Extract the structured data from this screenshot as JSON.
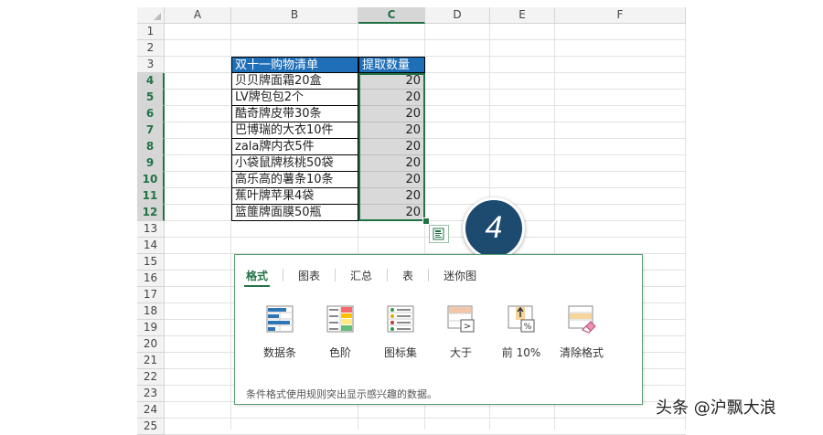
{
  "columns": [
    "A",
    "B",
    "C",
    "D",
    "E",
    "F"
  ],
  "rows": [
    "1",
    "2",
    "3",
    "4",
    "5",
    "6",
    "7",
    "8",
    "9",
    "10",
    "11",
    "12",
    "13",
    "14",
    "15",
    "16",
    "17",
    "18",
    "19",
    "20",
    "21",
    "22",
    "23",
    "24",
    "25"
  ],
  "table": {
    "header": [
      "双十一购物清单",
      "提取数量"
    ],
    "items": [
      {
        "name": "贝贝牌面霜20盒",
        "qty": "20"
      },
      {
        "name": "LV牌包包2个",
        "qty": "20"
      },
      {
        "name": "酷奇牌皮带30条",
        "qty": "20"
      },
      {
        "name": "巴博瑞的大衣10件",
        "qty": "20"
      },
      {
        "name": "zala牌内衣5件",
        "qty": "20"
      },
      {
        "name": "小袋鼠牌核桃50袋",
        "qty": "20"
      },
      {
        "name": "高乐高的薯条10条",
        "qty": "20"
      },
      {
        "name": "蕉叶牌苹果4袋",
        "qty": "20"
      },
      {
        "name": "篮篚牌面膜50瓶",
        "qty": "20"
      }
    ]
  },
  "badge": "4",
  "quick_analysis": {
    "tabs": [
      "格式",
      "图表",
      "汇总",
      "表",
      "迷你图"
    ],
    "options": [
      {
        "label": "数据条",
        "icon": "data-bars-icon"
      },
      {
        "label": "色阶",
        "icon": "color-scale-icon"
      },
      {
        "label": "图标集",
        "icon": "icon-set-icon"
      },
      {
        "label": "大于",
        "icon": "greater-than-icon"
      },
      {
        "label": "前 10%",
        "icon": "top-10-percent-icon"
      },
      {
        "label": "清除格式",
        "icon": "clear-format-icon"
      }
    ],
    "description": "条件格式使用规则突出显示感兴趣的数据。"
  },
  "watermark": "头条 @沪飘大浪",
  "colors": {
    "header_fill": "#1f6fb8",
    "selection": "#217346",
    "badge": "#1d4a6f",
    "selected_fill": "#d9d9d9"
  }
}
